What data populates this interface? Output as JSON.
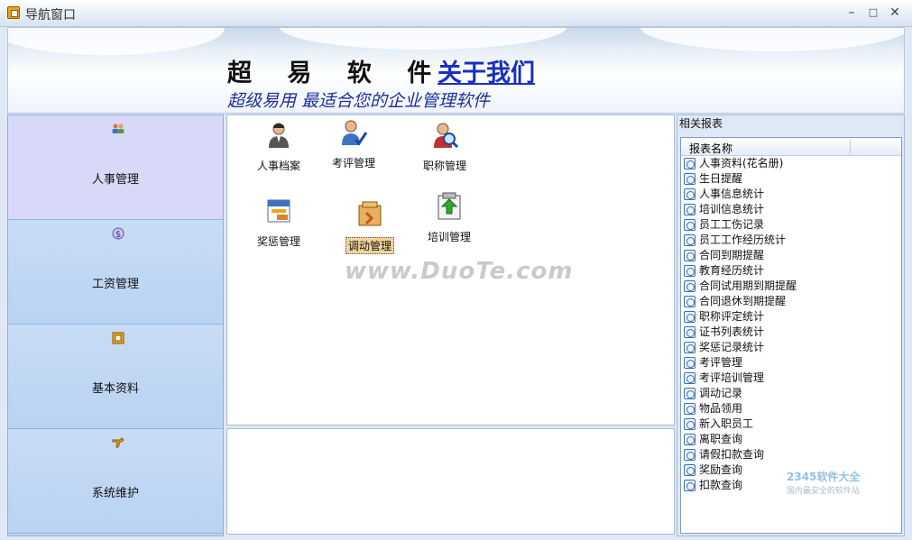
{
  "window": {
    "title": "导航窗口"
  },
  "banner": {
    "brand": "超 易 软 件",
    "about_link": "关于我们",
    "slogan": "超级易用 最适合您的企业管理软件"
  },
  "nav": {
    "items": [
      {
        "label": "人事管理",
        "icon": "people-icon",
        "active": true
      },
      {
        "label": "工资管理",
        "icon": "money-icon",
        "active": false
      },
      {
        "label": "基本资料",
        "icon": "document-icon",
        "active": false
      },
      {
        "label": "系统维护",
        "icon": "tools-icon",
        "active": false
      }
    ]
  },
  "main": {
    "tiles": [
      {
        "label": "人事档案",
        "icon": "person-icon"
      },
      {
        "label": "考评管理",
        "icon": "evaluation-icon"
      },
      {
        "label": "职称管理",
        "icon": "title-search-icon"
      },
      {
        "label": "奖惩管理",
        "icon": "award-icon"
      },
      {
        "label": "调动管理",
        "icon": "transfer-icon",
        "selected": true
      },
      {
        "label": "培训管理",
        "icon": "training-icon"
      }
    ],
    "watermark": "www.DuoTe.com"
  },
  "reports": {
    "title": "相关报表",
    "column_header": "报表名称",
    "items": [
      "人事资料(花名册)",
      "生日提醒",
      "人事信息统计",
      "培训信息统计",
      "员工工伤记录",
      "员工工作经历统计",
      "合同到期提醒",
      "教育经历统计",
      "合同试用期到期提醒",
      "合同退休到期提醒",
      "职称评定统计",
      "证书列表统计",
      "奖惩记录统计",
      "考评管理",
      "考评培训管理",
      "调动记录",
      "物品领用",
      "新入职员工",
      "离职查询",
      "请假扣款查询",
      "奖励查询",
      "扣款查询"
    ]
  },
  "corner_logo": {
    "text": "2345软件大全",
    "sub": "国内最安全的软件站"
  }
}
